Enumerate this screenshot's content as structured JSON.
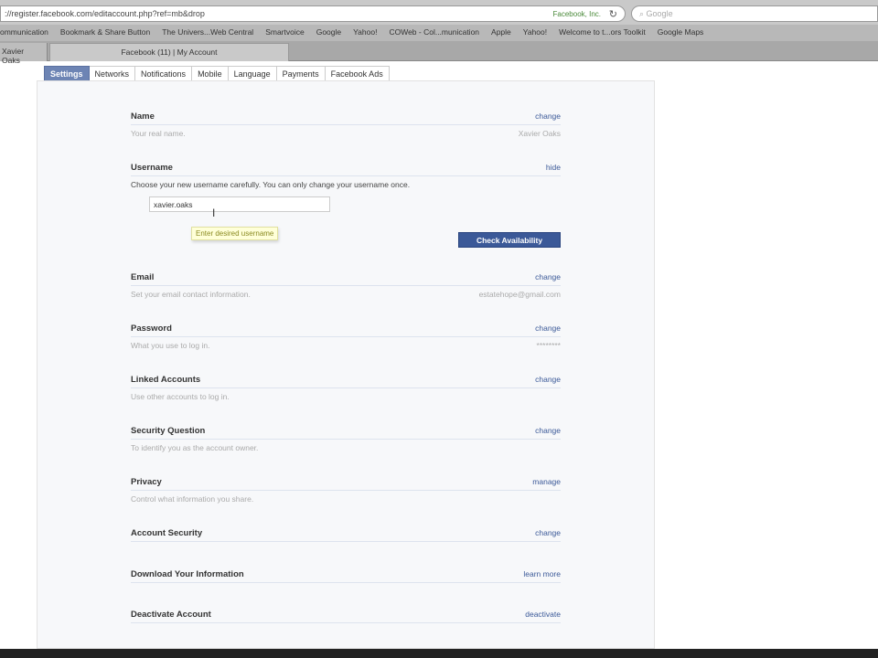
{
  "browser": {
    "url": "://register.facebook.com/editaccount.php?ref=mb&drop",
    "site_identity": "Facebook, Inc.",
    "search_placeholder": "Google",
    "bookmarks": [
      "ommunication",
      "Bookmark & Share Button",
      "The Univers...Web Central",
      "Smartvoice",
      "Google",
      "Yahoo!",
      "COWeb - Col...munication",
      "Apple",
      "Yahoo!",
      "Welcome to t...ors Toolkit",
      "Google Maps"
    ],
    "tabs": [
      "Xavier Oaks",
      "Facebook (11) | My Account"
    ]
  },
  "subtabs": [
    "Settings",
    "Networks",
    "Notifications",
    "Mobile",
    "Language",
    "Payments",
    "Facebook Ads"
  ],
  "sections": {
    "name": {
      "title": "Name",
      "action": "change",
      "desc": "Your real name.",
      "value": "Xavier Oaks"
    },
    "username": {
      "title": "Username",
      "action": "hide",
      "desc": "Choose your new username carefully. You can only change your username once.",
      "input_value": "xavier.oaks",
      "tooltip": "Enter desired username",
      "button": "Check Availability"
    },
    "email": {
      "title": "Email",
      "action": "change",
      "desc": "Set your email contact information.",
      "value": "estatehope@gmail.com"
    },
    "password": {
      "title": "Password",
      "action": "change",
      "desc": "What you use to log in.",
      "value": "********"
    },
    "linked": {
      "title": "Linked Accounts",
      "action": "change",
      "desc": "Use other accounts to log in."
    },
    "security_question": {
      "title": "Security Question",
      "action": "change",
      "desc": "To identify you as the account owner."
    },
    "privacy": {
      "title": "Privacy",
      "action": "manage",
      "desc": "Control what information you share."
    },
    "account_security": {
      "title": "Account Security",
      "action": "change"
    },
    "download": {
      "title": "Download Your Information",
      "action": "learn more"
    },
    "deactivate": {
      "title": "Deactivate Account",
      "action": "deactivate"
    }
  }
}
